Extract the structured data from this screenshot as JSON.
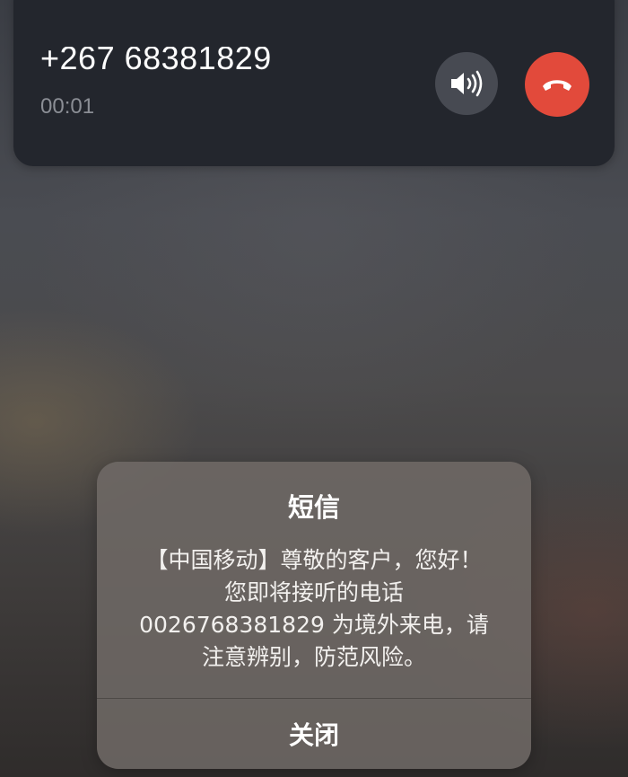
{
  "call": {
    "number": "+267 68381829",
    "duration": "00:01",
    "speaker_icon": "speaker-icon",
    "end_call_icon": "phone-hangup-icon",
    "end_call_color": "#e24a3b"
  },
  "alert": {
    "title": "短信",
    "message_lines": [
      "【中国移动】尊敬的客户，您好！",
      "您即将接听的电话",
      "0026768381829 为境外来电，请",
      "注意辨别，防范风险。"
    ],
    "close_label": "关闭"
  }
}
